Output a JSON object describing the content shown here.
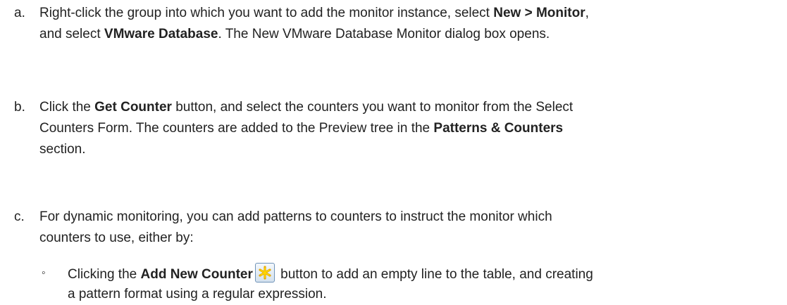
{
  "steps": [
    {
      "letter": "a.",
      "lines": [
        [
          {
            "t": "Right-click the group into which you want to add the monitor instance, select ",
            "b": false
          },
          {
            "t": "New > Monitor",
            "b": true
          },
          {
            "t": ",",
            "b": false
          }
        ],
        [
          {
            "t": "and select ",
            "b": false
          },
          {
            "t": "VMware Database",
            "b": true
          },
          {
            "t": ". The New VMware Database Monitor dialog box opens.",
            "b": false
          }
        ]
      ]
    },
    {
      "letter": "b.",
      "lines": [
        [
          {
            "t": "Click the ",
            "b": false
          },
          {
            "t": "Get Counter",
            "b": true
          },
          {
            "t": " button, and select the counters you want to monitor from the Select",
            "b": false
          }
        ],
        [
          {
            "t": "Counters Form. The counters are added to the Preview tree in the ",
            "b": false
          },
          {
            "t": "Patterns & Counters",
            "b": true
          }
        ],
        [
          {
            "t": "section.",
            "b": false
          }
        ]
      ]
    },
    {
      "letter": "c.",
      "lines": [
        [
          {
            "t": "For dynamic monitoring, you can add patterns to counters to instruct the monitor which",
            "b": false
          }
        ],
        [
          {
            "t": "counters to use, either by:",
            "b": false
          }
        ]
      ]
    }
  ],
  "sub_items": [
    {
      "bullet": "◦",
      "line1_before": "Clicking the ",
      "line1_bold": "Add New Counter",
      "icon": "add-new-counter-icon",
      "icon_color": "#f5c400",
      "line1_after": " button to add an empty line to the table, and creating",
      "line2": "a pattern format using a regular expression."
    }
  ]
}
